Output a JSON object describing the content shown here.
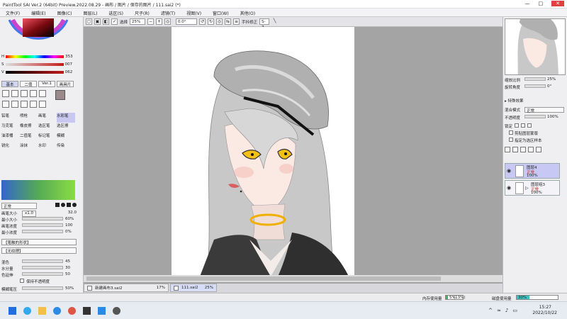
{
  "window": {
    "title": "PaintTool SAI Ver.2 (64bit) Preview.2022.08.29 - 画布 / 图片 / 保存的图片 / 111.sai2 (*)",
    "controls": {
      "minimize": "—",
      "maximize": "□",
      "close": "✕"
    }
  },
  "menu": [
    "文件(F)",
    "编辑(E)",
    "图像(C)",
    "图层(L)",
    "选区(S)",
    "尺子(R)",
    "滤镜(T)",
    "视图(V)",
    "窗口(W)",
    "其他(O)"
  ],
  "toolbar": {
    "select_label": "选择",
    "zoom": "25%",
    "angle": "0.0°",
    "stabilizer_label": "手抖修正",
    "stabilizer_value": "S-7"
  },
  "color": {
    "h": "353",
    "s": "007",
    "v": "062",
    "accent": "#c61a1a"
  },
  "tool_tabs": [
    "基本",
    "二值",
    "Ver.1",
    "画具片"
  ],
  "tools": [
    "铅笔",
    "喷枪",
    "画笔",
    "水彩笔",
    "马克笔",
    "橡皮擦",
    "选区笔",
    "选区擦",
    "油漆桶",
    "二值笔",
    "标记笔",
    "模糊",
    "锐化",
    "涂抹",
    "水印",
    "传染"
  ],
  "brush": {
    "mode": "正常",
    "size_label": "画笔大小",
    "size_mult": "x1.0",
    "size_value": "32.0",
    "min_size_label": "最小大小",
    "min_size_value": "60%",
    "density_label": "画笔浓度",
    "density_value": "100",
    "min_density_label": "最小浓度",
    "min_density_value": "0%",
    "shape_label": "【笔触的形状】",
    "texture_label": "【无纹理】",
    "blend_label": "混色",
    "blend_value": "45",
    "water_label": "水分量",
    "water_value": "30",
    "persist_label": "色延伸",
    "persist_value": "50",
    "keep_opacity_label": "保持不透明度",
    "blur_label": "模糊笔压",
    "blur_value": "50%",
    "sizes": [
      "10",
      "12",
      "14",
      "16",
      "20"
    ]
  },
  "navigator": {
    "zoom_label": "缩放比例",
    "zoom_value": "25%",
    "angle_label": "旋转角度",
    "angle_value": "0°"
  },
  "layer_panel": {
    "effects_label": "▸ 特殊效果",
    "blend_mode_label": "混合模式",
    "blend_mode_value": "正常",
    "opacity_label": "不透明度",
    "opacity_value": "100%",
    "lock_label": "锁定",
    "clip_label": "剪贴图层蒙版",
    "selection_source_label": "指定为选区样本",
    "layers": [
      {
        "name": "图层4",
        "mode": "正常",
        "opacity": "100%"
      },
      {
        "name": "图层组3",
        "mode": "正常",
        "opacity": "100%"
      }
    ]
  },
  "doc_tabs": [
    {
      "name": "新建画布3.sai2",
      "zoom": "17%"
    },
    {
      "name": "111.sai2",
      "zoom": "25%"
    }
  ],
  "status": {
    "memory_label": "内存使用量",
    "memory_value": "5%",
    "memory_paren": "(13%)",
    "disk_label": "磁盘使用量",
    "disk_value": "30%"
  },
  "taskbar": {
    "time": "15:27",
    "date": "2022/10/22"
  }
}
